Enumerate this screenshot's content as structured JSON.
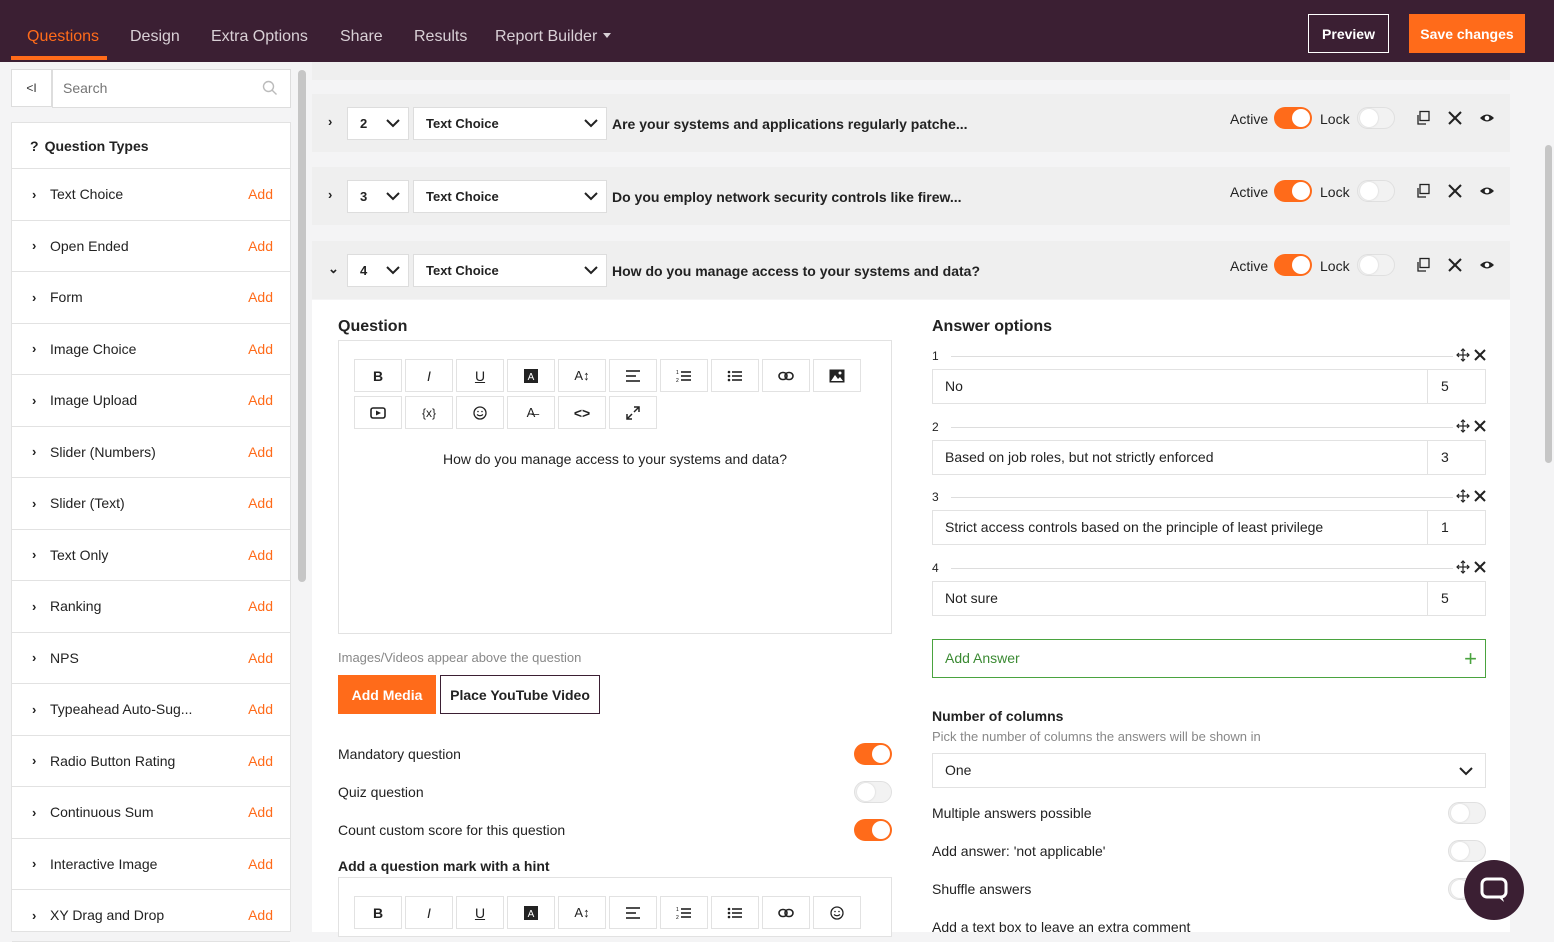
{
  "nav": {
    "tabs": [
      {
        "label": "Questions",
        "active": true
      },
      {
        "label": "Design"
      },
      {
        "label": "Extra Options"
      },
      {
        "label": "Share"
      },
      {
        "label": "Results"
      },
      {
        "label": "Report Builder"
      }
    ],
    "preview_label": "Preview",
    "save_label": "Save changes"
  },
  "colors": {
    "accent": "#ff6b1a",
    "topbar": "#3b1f33",
    "success": "#4aa33f"
  },
  "sidebar": {
    "collapse_label": "<I",
    "search_placeholder": "Search",
    "section_title": "Question Types",
    "add_label": "Add",
    "items": [
      "Text Choice",
      "Open Ended",
      "Form",
      "Image Choice",
      "Image Upload",
      "Slider (Numbers)",
      "Slider (Text)",
      "Text Only",
      "Ranking",
      "NPS",
      "Typeahead Auto-Sug...",
      "Radio Button Rating",
      "Continuous Sum",
      "Interactive Image",
      "XY Drag and Drop"
    ]
  },
  "questions": [
    {
      "number": "2",
      "type": "Text Choice",
      "title": "Are your systems and applications regularly patche...",
      "active_label": "Active",
      "lock_label": "Lock"
    },
    {
      "number": "3",
      "type": "Text Choice",
      "title": "Do you employ network security controls like firew...",
      "active_label": "Active",
      "lock_label": "Lock"
    },
    {
      "number": "4",
      "type": "Text Choice",
      "title": "How do you manage access to your systems and data?",
      "active_label": "Active",
      "lock_label": "Lock"
    }
  ],
  "editor": {
    "question_heading": "Question",
    "question_text": "How do you manage access to your systems and data?",
    "media_hint": "Images/Videos appear above the question",
    "add_media_label": "Add Media",
    "youtube_label": "Place YouTube Video",
    "mandatory_label": "Mandatory question",
    "quiz_label": "Quiz question",
    "custom_score_label": "Count custom score for this question",
    "hint_heading": "Add a question mark with a hint",
    "toolbar_text": {
      "bold": "B",
      "italic": "I",
      "underline": "U",
      "var": "{x}"
    }
  },
  "answers": {
    "heading": "Answer options",
    "items": [
      {
        "index": "1",
        "text": "No",
        "score": "5"
      },
      {
        "index": "2",
        "text": "Based on job roles, but not strictly enforced",
        "score": "3"
      },
      {
        "index": "3",
        "text": "Strict access controls based on the principle of least privilege",
        "score": "1"
      },
      {
        "index": "4",
        "text": "Not sure",
        "score": "5"
      }
    ],
    "add_answer_label": "Add Answer",
    "columns_heading": "Number of columns",
    "columns_hint": "Pick the number of columns the answers will be shown in",
    "columns_value": "One",
    "multiple_label": "Multiple answers possible",
    "na_label": "Add answer: 'not applicable'",
    "shuffle_label": "Shuffle answers",
    "comment_label": "Add a text box to leave an extra comment"
  }
}
